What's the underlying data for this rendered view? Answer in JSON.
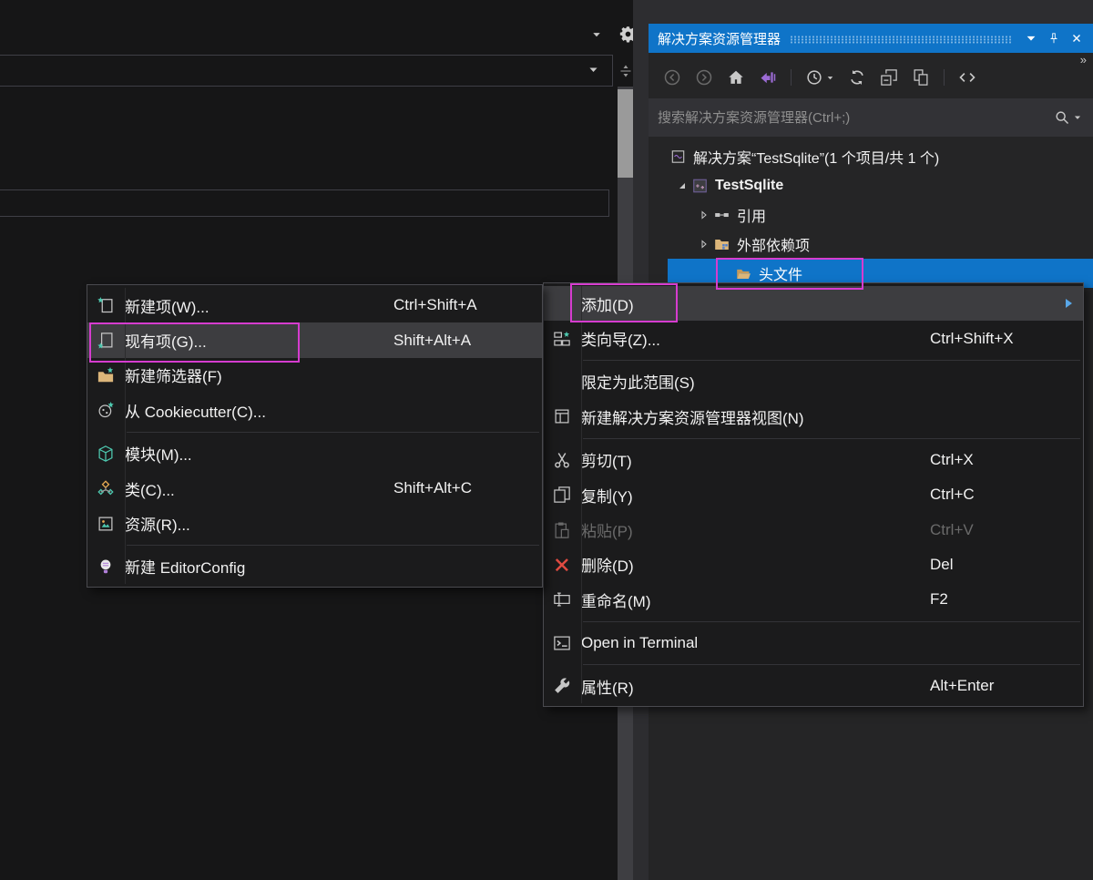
{
  "colors": {
    "accent_blue": "#0f74c8",
    "selection_blue": "#0f74c8",
    "menu_background": "#1b1b1c",
    "menu_highlight": "#3d3d40",
    "panel_background": "#252526",
    "annotation_pink": "#d63ccf",
    "delete_icon_red": "#e04b41",
    "folder_yellow": "#dcb67a"
  },
  "editor_chrome": {
    "top_icons": [
      "chevron-down",
      "gear"
    ],
    "overflow_chevron": "»",
    "scrollbar_split_icon": "split"
  },
  "solution_explorer": {
    "title": "解决方案资源管理器",
    "titlebar_icons": [
      "chevron-down",
      "pin",
      "close"
    ],
    "search_placeholder": "搜索解决方案资源管理器(Ctrl+;)",
    "search_icons": [
      "search",
      "chevron-down"
    ],
    "toolbar_icons": [
      {
        "name": "back",
        "disabled": true
      },
      {
        "name": "forward",
        "disabled": true
      },
      {
        "name": "home"
      },
      {
        "name": "sync-active-document",
        "color": "#9b6bd4"
      },
      {
        "name": "separator"
      },
      {
        "name": "pending-changes",
        "caret": true
      },
      {
        "name": "refresh"
      },
      {
        "name": "collapse-all"
      },
      {
        "name": "preview-selected"
      },
      {
        "name": "separator"
      },
      {
        "name": "view-code"
      }
    ],
    "tree": [
      {
        "id": "solution",
        "label": "解决方案“TestSqlite”(1 个项目/共 1 个)",
        "icon": "solution",
        "depth": 0,
        "expander": "none"
      },
      {
        "id": "project-testsqlite",
        "label": "TestSqlite",
        "icon": "project-cpp",
        "depth": 1,
        "expander": "expanded",
        "bold": true
      },
      {
        "id": "references",
        "label": "引用",
        "icon": "references",
        "depth": 2,
        "expander": "collapsed"
      },
      {
        "id": "external-dependencies",
        "label": "外部依赖项",
        "icon": "folder-deps",
        "depth": 2,
        "expander": "collapsed"
      },
      {
        "id": "header-files",
        "label": "头文件",
        "icon": "folder-open",
        "depth": 3,
        "expander": "none",
        "selected": true
      }
    ]
  },
  "context_menu": {
    "items": [
      {
        "id": "add",
        "label": "添加(D)",
        "has_submenu": true,
        "highlighted": true
      },
      {
        "id": "class-wizard",
        "label": "类向导(Z)...",
        "shortcut": "Ctrl+Shift+X",
        "icon": "class-wizard"
      },
      {
        "type": "separator"
      },
      {
        "id": "scope-to-this",
        "label": "限定为此范围(S)"
      },
      {
        "id": "new-solution-explorer-view",
        "label": "新建解决方案资源管理器视图(N)",
        "icon": "new-view"
      },
      {
        "type": "separator"
      },
      {
        "id": "cut",
        "label": "剪切(T)",
        "shortcut": "Ctrl+X",
        "icon": "scissors"
      },
      {
        "id": "copy",
        "label": "复制(Y)",
        "shortcut": "Ctrl+C",
        "icon": "copy"
      },
      {
        "id": "paste",
        "label": "粘贴(P)",
        "shortcut": "Ctrl+V",
        "icon": "paste",
        "disabled": true
      },
      {
        "id": "delete",
        "label": "删除(D)",
        "shortcut": "Del",
        "icon": "delete"
      },
      {
        "id": "rename",
        "label": "重命名(M)",
        "shortcut": "F2",
        "icon": "rename"
      },
      {
        "type": "separator"
      },
      {
        "id": "open-in-terminal",
        "label": "Open in Terminal",
        "icon": "terminal"
      },
      {
        "type": "separator"
      },
      {
        "id": "properties",
        "label": "属性(R)",
        "shortcut": "Alt+Enter",
        "icon": "wrench"
      }
    ]
  },
  "add_submenu": {
    "items": [
      {
        "id": "new-item",
        "label": "新建项(W)...",
        "shortcut": "Ctrl+Shift+A",
        "icon": "new-item"
      },
      {
        "id": "existing-item",
        "label": "现有项(G)...",
        "shortcut": "Shift+Alt+A",
        "icon": "existing-item",
        "highlighted": true
      },
      {
        "id": "new-filter",
        "label": "新建筛选器(F)",
        "icon": "new-filter"
      },
      {
        "id": "from-cookiecutter",
        "label": "从 Cookiecutter(C)...",
        "icon": "cookiecutter"
      },
      {
        "type": "separator"
      },
      {
        "id": "module",
        "label": "模块(M)...",
        "icon": "module"
      },
      {
        "id": "class",
        "label": "类(C)...",
        "shortcut": "Shift+Alt+C",
        "icon": "class"
      },
      {
        "id": "resource",
        "label": "资源(R)...",
        "icon": "resource"
      },
      {
        "type": "separator"
      },
      {
        "id": "new-editorconfig",
        "label": "新建 EditorConfig",
        "icon": "editorconfig"
      }
    ]
  },
  "annotations": [
    {
      "target": "tree-item-header-files"
    },
    {
      "target": "menu-item-add"
    },
    {
      "target": "menu-item-existing-item"
    }
  ]
}
